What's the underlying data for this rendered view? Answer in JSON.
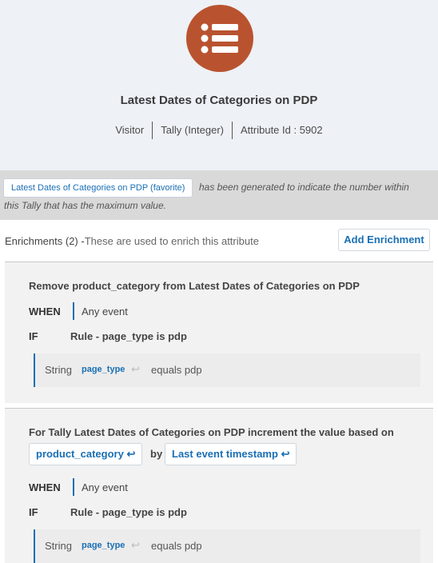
{
  "header": {
    "title": "Latest Dates of Categories on PDP",
    "meta": [
      "Visitor",
      "Tally (Integer)",
      "Attribute Id : 5902"
    ],
    "logo_color": "#b9532f"
  },
  "notice": {
    "chip": "Latest Dates of Categories on PDP (favorite)",
    "line1": "has been generated to indicate the number within",
    "line2": "this Tally that has the maximum value."
  },
  "enrichments": {
    "label": "Enrichments (2) -",
    "sub": "These are used to enrich this attribute",
    "add_button": "Add Enrichment",
    "cards": [
      {
        "title": "Remove product_category from Latest Dates of Categories on PDP",
        "when_kw": "WHEN",
        "when_value": "Any event",
        "if_kw": "IF",
        "rule": "Rule - page_type is pdp",
        "cond_type": "String",
        "cond_field": "page_type",
        "cond_expr": "equals pdp"
      },
      {
        "title": "For Tally Latest Dates of Categories on PDP increment the value based on",
        "pill1": "product_category",
        "by": "by",
        "pill2": "Last event timestamp",
        "when_kw": "WHEN",
        "when_value": "Any event",
        "if_kw": "IF",
        "rule": "Rule - page_type is pdp",
        "cond_type": "String",
        "cond_field": "page_type",
        "cond_expr": "equals pdp"
      }
    ]
  },
  "icons": {
    "logo": "list-icon",
    "field_link": "undo-arrow-icon"
  },
  "colors": {
    "accent": "#1a6fb5",
    "brand": "#b9532f"
  }
}
